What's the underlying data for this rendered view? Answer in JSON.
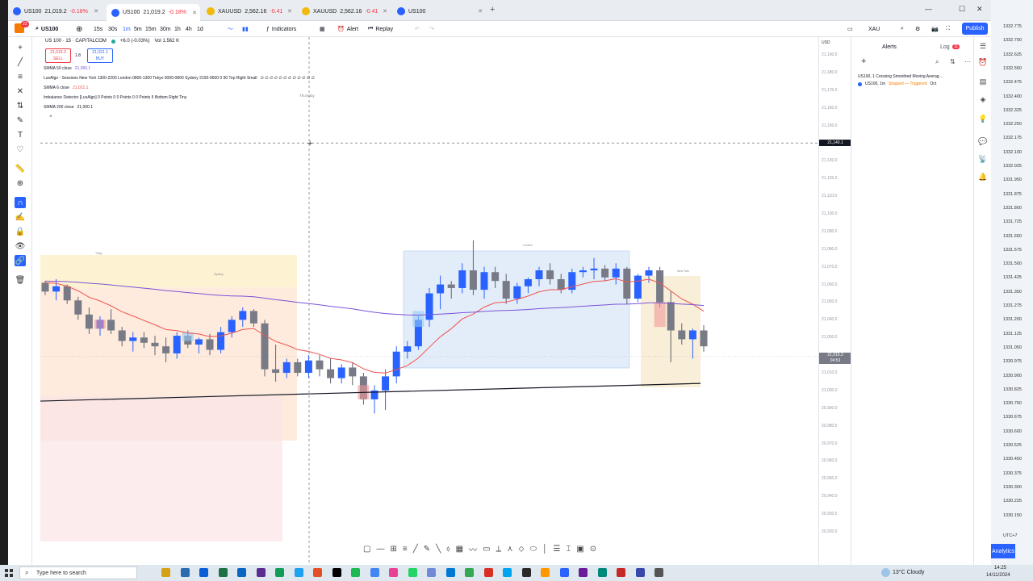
{
  "browser_tabs": [
    {
      "ticker": "US100",
      "price": "21,019.2",
      "change": "-0.18%",
      "active": false,
      "color": "#2962ff"
    },
    {
      "ticker": "US100",
      "price": "21,019.2",
      "change": "-0.18%",
      "active": true,
      "color": "#2962ff"
    },
    {
      "ticker": "XAUUSD",
      "price": "2,562.16",
      "change": "-0.41",
      "active": false,
      "color": "#f0b90b"
    },
    {
      "ticker": "XAUUSD",
      "price": "2,562.16",
      "change": "-0.41",
      "active": false,
      "color": "#f0b90b"
    },
    {
      "ticker": "US100",
      "price": "",
      "change": "",
      "active": false,
      "color": "#2962ff"
    }
  ],
  "toolbar": {
    "symbol": "US100",
    "intervals": [
      "15s",
      "30s",
      "1m",
      "5m",
      "15m",
      "30m",
      "1h",
      "4h",
      "1d"
    ],
    "active_interval": "1m",
    "indicators": "Indicators",
    "alert": "Alert",
    "replay": "Replay",
    "right_symbol": "XAU",
    "publish": "Publish",
    "notif_count": "22"
  },
  "legend": {
    "title": "US 100 · 15 · CAPITALCOM",
    "change": "+6.0 (-0.03%)",
    "volume": "Vol 1.562 K",
    "sell_price": "21,019.3",
    "sell_label": "SELL",
    "spread": "1.8",
    "buy_price": "21,021.1",
    "buy_label": "BUY"
  },
  "indicators": [
    {
      "name": "SMMA 50 close",
      "value": "21,050.1",
      "color": "#7b52d6"
    },
    {
      "name": "LuxAlgo - Sessions New York 1300-2200 London 0800-1300 Tokyo 0000-0800 Sydney 2100-0600 0 90 Top Right Small",
      "value": "∅ ∅ ∅ ∅ ∅ ∅ ∅ ∅ ∅ ∅ ∅ ∅",
      "color": "#131722"
    },
    {
      "name": "SMMA 6 close",
      "value": "21,021.1",
      "color": "#ef5350"
    },
    {
      "name": "Imbalance Detector [LuxAlgo] 0 Points 0 0 Points 0 0 Points 5 Bottom Right Tiny",
      "value": "",
      "color": "#131722"
    },
    {
      "name": "SMMA 200 close",
      "value": "21,000.1",
      "color": "#131722"
    }
  ],
  "chart_labels": {
    "thursday": "Thursday",
    "london": "London",
    "new_york": "New York",
    "tokyo": "Tokyo",
    "sydney": "Sydney"
  },
  "price_scale": {
    "currency": "USD",
    "labels": [
      "21,190.0",
      "21,180.0",
      "21,170.0",
      "21,160.0",
      "21,150.0",
      "21,140.0",
      "21,130.0",
      "21,120.0",
      "21,110.0",
      "21,100.0",
      "21,090.0",
      "21,080.0",
      "21,070.0",
      "21,060.0",
      "21,050.0",
      "21,040.0",
      "21,030.0",
      "21,020.0",
      "21,010.0",
      "21,000.0",
      "20,990.0",
      "20,980.0",
      "20,970.0",
      "20,960.0",
      "20,950.0",
      "20,940.0",
      "20,930.0",
      "20,920.0"
    ],
    "crosshair_price": "21,140.1",
    "last_price": "21,019.2",
    "countdown": "04:53"
  },
  "chart_data": {
    "type": "candlestick",
    "y_range": [
      20915,
      21195
    ],
    "crosshair_price": 21140.1,
    "last_price": 21019.2,
    "candles": [
      [
        21061,
        21062,
        21054,
        21056
      ],
      [
        21056,
        21063,
        21051,
        21059
      ],
      [
        21059,
        21060,
        21049,
        21051
      ],
      [
        21051,
        21053,
        21040,
        21043
      ],
      [
        21043,
        21047,
        21032,
        21035
      ],
      [
        21035,
        21042,
        21031,
        21040
      ],
      [
        21040,
        21046,
        21032,
        21034
      ],
      [
        21034,
        21036,
        21025,
        21028
      ],
      [
        21028,
        21033,
        21022,
        21030
      ],
      [
        21030,
        21033,
        21024,
        21027
      ],
      [
        21027,
        21031,
        21020,
        21025
      ],
      [
        21025,
        21030,
        21016,
        21021
      ],
      [
        21021,
        21033,
        21018,
        21031
      ],
      [
        21031,
        21034,
        21024,
        21026
      ],
      [
        21026,
        21030,
        21021,
        21029
      ],
      [
        21029,
        21032,
        21020,
        21023
      ],
      [
        21023,
        21036,
        21021,
        21033
      ],
      [
        21033,
        21042,
        21030,
        21040
      ],
      [
        21040,
        21047,
        21036,
        21045
      ],
      [
        21045,
        21046,
        21036,
        21038
      ],
      [
        21038,
        21040,
        21008,
        21012
      ],
      [
        21012,
        21026,
        21005,
        21010
      ],
      [
        21010,
        21018,
        21007,
        21016
      ],
      [
        21016,
        21018,
        21008,
        21010
      ],
      [
        21010,
        21020,
        21007,
        21017
      ],
      [
        21017,
        21020,
        21008,
        21012
      ],
      [
        21012,
        21018,
        21004,
        21007
      ],
      [
        21007,
        21015,
        21004,
        21013
      ],
      [
        21013,
        21016,
        21003,
        21008
      ],
      [
        21008,
        21010,
        20992,
        20995
      ],
      [
        20995,
        21003,
        20987,
        21000
      ],
      [
        21000,
        21012,
        20989,
        21008
      ],
      [
        21008,
        21025,
        21004,
        21022
      ],
      [
        21022,
        21028,
        21018,
        21025
      ],
      [
        21025,
        21042,
        21023,
        21040
      ],
      [
        21040,
        21058,
        21036,
        21055
      ],
      [
        21055,
        21065,
        21046,
        21060
      ],
      [
        21060,
        21062,
        21052,
        21058
      ],
      [
        21058,
        21072,
        21055,
        21068
      ],
      [
        21068,
        21085,
        21054,
        21057
      ],
      [
        21057,
        21070,
        21052,
        21067
      ],
      [
        21067,
        21070,
        21058,
        21062
      ],
      [
        21062,
        21066,
        21049,
        21052
      ],
      [
        21052,
        21061,
        21049,
        21059
      ],
      [
        21059,
        21064,
        21055,
        21063
      ],
      [
        21063,
        21070,
        21059,
        21068
      ],
      [
        21068,
        21072,
        21060,
        21063
      ],
      [
        21063,
        21066,
        21055,
        21057
      ],
      [
        21057,
        21069,
        21055,
        21067
      ],
      [
        21067,
        21070,
        21064,
        21068
      ],
      [
        21068,
        21075,
        21063,
        21069
      ],
      [
        21069,
        21071,
        21062,
        21064
      ],
      [
        21064,
        21072,
        21060,
        21069
      ],
      [
        21069,
        21070,
        21049,
        21052
      ],
      [
        21052,
        21066,
        21050,
        21065
      ],
      [
        21065,
        21070,
        21061,
        21068
      ],
      [
        21068,
        21070,
        21047,
        21050
      ],
      [
        21050,
        21056,
        21016,
        21034
      ],
      [
        21034,
        21038,
        21026,
        21029
      ],
      [
        21029,
        21035,
        21018,
        21034
      ],
      [
        21034,
        21037,
        21022,
        21025
      ]
    ]
  },
  "right_panel": {
    "tab_alerts": "Alerts",
    "tab_log": "Log",
    "log_count": "11",
    "alert_title": "US100, 1 Crossing Smoothed Moving Averag…",
    "alert_detail": "US100, 1m",
    "alert_status": "Stopped — Triggered",
    "alert_date": "Oct"
  },
  "side_window": {
    "prices": [
      "1332.775",
      "1332.700",
      "1332.625",
      "1332.550",
      "1332.475",
      "1332.400",
      "1332.325",
      "1332.250",
      "1332.175",
      "1332.100",
      "1332.025",
      "1331.950",
      "1331.875",
      "1331.800",
      "1331.725",
      "1331.650",
      "1331.575",
      "1331.500",
      "1331.425",
      "1331.350",
      "1331.275",
      "1331.200",
      "1331.125",
      "1331.050",
      "1330.975",
      "1330.900",
      "1330.825",
      "1330.750",
      "1330.675",
      "1330.600",
      "1330.525",
      "1330.450",
      "1330.375",
      "1330.300",
      "1330.225",
      "1330.150"
    ],
    "timezone": "UTC+7",
    "analytics": "Analytics"
  },
  "taskbar": {
    "search": "Type here to search",
    "weather": "13°C  Cloudy",
    "time": "14:25",
    "date": "14/11/2024"
  }
}
